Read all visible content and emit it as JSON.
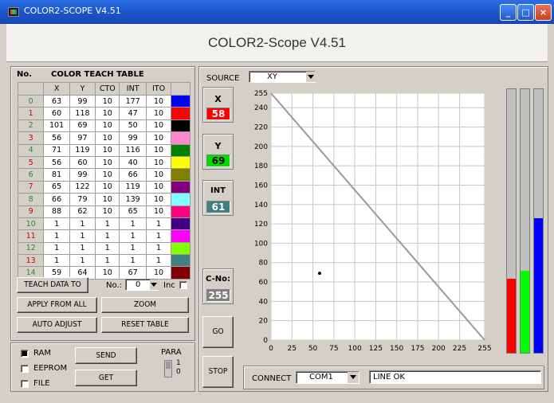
{
  "window": {
    "title": "COLOR2-SCOPE V4.51",
    "heading": "COLOR2-Scope V4.51"
  },
  "table": {
    "no_label": "No.",
    "title": "COLOR TEACH TABLE",
    "columns": [
      "X",
      "Y",
      "CTO",
      "INT",
      "ITO"
    ],
    "rows": [
      {
        "no": "0",
        "x": "63",
        "y": "99",
        "cto": "10",
        "int": "177",
        "ito": "10",
        "color": "#0000ff"
      },
      {
        "no": "1",
        "x": "60",
        "y": "118",
        "cto": "10",
        "int": "47",
        "ito": "10",
        "color": "#ff0000"
      },
      {
        "no": "2",
        "x": "101",
        "y": "69",
        "cto": "10",
        "int": "50",
        "ito": "10",
        "color": "#000000"
      },
      {
        "no": "3",
        "x": "56",
        "y": "97",
        "cto": "10",
        "int": "99",
        "ito": "10",
        "color": "#ff88cc"
      },
      {
        "no": "4",
        "x": "71",
        "y": "119",
        "cto": "10",
        "int": "116",
        "ito": "10",
        "color": "#008000"
      },
      {
        "no": "5",
        "x": "56",
        "y": "60",
        "cto": "10",
        "int": "40",
        "ito": "10",
        "color": "#ffff00"
      },
      {
        "no": "6",
        "x": "81",
        "y": "99",
        "cto": "10",
        "int": "66",
        "ito": "10",
        "color": "#808000"
      },
      {
        "no": "7",
        "x": "65",
        "y": "122",
        "cto": "10",
        "int": "119",
        "ito": "10",
        "color": "#800080"
      },
      {
        "no": "8",
        "x": "66",
        "y": "79",
        "cto": "10",
        "int": "139",
        "ito": "10",
        "color": "#80ffff"
      },
      {
        "no": "9",
        "x": "88",
        "y": "62",
        "cto": "10",
        "int": "65",
        "ito": "10",
        "color": "#ff0080"
      },
      {
        "no": "10",
        "x": "1",
        "y": "1",
        "cto": "1",
        "int": "1",
        "ito": "1",
        "color": "#400080"
      },
      {
        "no": "11",
        "x": "1",
        "y": "1",
        "cto": "1",
        "int": "1",
        "ito": "1",
        "color": "#ff00ff"
      },
      {
        "no": "12",
        "x": "1",
        "y": "1",
        "cto": "1",
        "int": "1",
        "ito": "1",
        "color": "#80ff00"
      },
      {
        "no": "13",
        "x": "1",
        "y": "1",
        "cto": "1",
        "int": "1",
        "ito": "1",
        "color": "#408080"
      },
      {
        "no": "14",
        "x": "59",
        "y": "64",
        "cto": "10",
        "int": "67",
        "ito": "10",
        "color": "#800000"
      }
    ]
  },
  "buttons": {
    "teach": "TEACH DATA TO",
    "no_label": "No.:",
    "no_value": "0",
    "inc_label": "Inc",
    "apply": "APPLY FROM ALL",
    "zoom": "ZOOM",
    "auto_adjust": "AUTO ADJUST",
    "reset": "RESET TABLE",
    "send": "SEND",
    "get": "GET",
    "go": "GO",
    "stop": "STOP"
  },
  "memory": {
    "ram": "RAM",
    "eeprom": "EEPROM",
    "file": "FILE",
    "para": "PARA",
    "para_1": "1",
    "para_0": "0",
    "ram_checked": true
  },
  "source": {
    "label": "SOURCE",
    "value": "XY"
  },
  "readouts": {
    "x_label": "X",
    "x_value": "58",
    "x_color": "#ff0000",
    "y_label": "Y",
    "y_value": "69",
    "y_color": "#00dd00",
    "int_label": "INT",
    "int_value": "61",
    "int_color": "#408080",
    "cno_label": "C-No:",
    "cno_value": "255",
    "cno_color": "#808080"
  },
  "chart_data": {
    "type": "scatter",
    "xlim": [
      0,
      255
    ],
    "ylim": [
      0,
      255
    ],
    "xticks": [
      "0",
      "25",
      "50",
      "75",
      "100",
      "125",
      "150",
      "175",
      "200",
      "225",
      "255"
    ],
    "yticks": [
      "0",
      "20",
      "40",
      "60",
      "80",
      "100",
      "120",
      "140",
      "160",
      "180",
      "200",
      "220",
      "240",
      "255"
    ],
    "grid": true,
    "line": {
      "x": [
        0,
        255
      ],
      "y": [
        255,
        0
      ]
    },
    "points": [
      {
        "x": 58,
        "y": 69
      }
    ]
  },
  "bars": [
    {
      "color": "#ff0000",
      "level": 0.28
    },
    {
      "color": "#00ff00",
      "level": 0.31
    },
    {
      "color": "#0000ff",
      "level": 0.51
    }
  ],
  "connect": {
    "label": "CONNECT",
    "port": "COM1",
    "status": "LINE OK"
  }
}
